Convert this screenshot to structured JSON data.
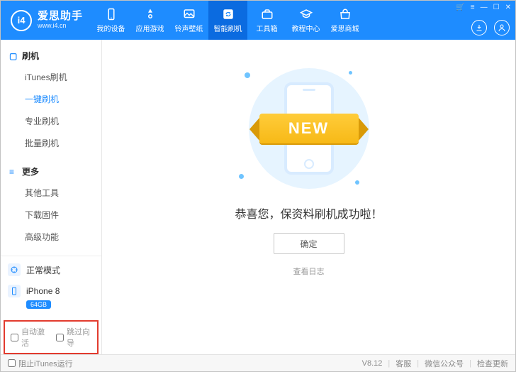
{
  "app": {
    "name": "爱思助手",
    "url": "www.i4.cn",
    "logo_text": "i4"
  },
  "header": {
    "tabs": [
      {
        "label": "我的设备"
      },
      {
        "label": "应用游戏"
      },
      {
        "label": "铃声壁纸"
      },
      {
        "label": "智能刷机"
      },
      {
        "label": "工具箱"
      },
      {
        "label": "教程中心"
      },
      {
        "label": "爱思商城"
      }
    ],
    "active_tab_index": 3
  },
  "sidebar": {
    "groups": [
      {
        "title": "刷机",
        "items": [
          {
            "label": "iTunes刷机"
          },
          {
            "label": "一键刷机"
          },
          {
            "label": "专业刷机"
          },
          {
            "label": "批量刷机"
          }
        ],
        "active_index": 1
      },
      {
        "title": "更多",
        "items": [
          {
            "label": "其他工具"
          },
          {
            "label": "下载固件"
          },
          {
            "label": "高级功能"
          }
        ]
      }
    ],
    "status": {
      "mode": "正常模式"
    },
    "device": {
      "name": "iPhone 8",
      "storage": "64GB"
    },
    "options": {
      "auto_activate": "自动激活",
      "skip_wizard": "跳过向导"
    }
  },
  "main": {
    "ribbon": "NEW",
    "success": "恭喜您，保资料刷机成功啦！",
    "ok": "确定",
    "view_log": "查看日志"
  },
  "footer": {
    "block_itunes": "阻止iTunes运行",
    "version": "V8.12",
    "support": "客服",
    "wechat": "微信公众号",
    "check_update": "检查更新"
  }
}
